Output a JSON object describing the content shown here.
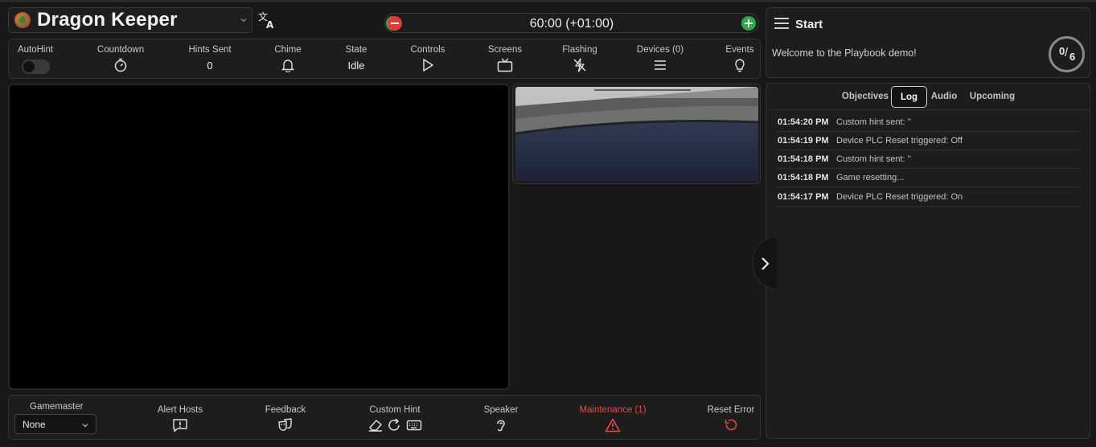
{
  "app": {
    "title": "Dragon Keeper"
  },
  "timer": {
    "display": "60:00 (+01:00)"
  },
  "toolbar": {
    "autohint": {
      "label": "AutoHint",
      "on": false
    },
    "countdown": {
      "label": "Countdown"
    },
    "hints_sent": {
      "label": "Hints Sent",
      "value": "0"
    },
    "chime": {
      "label": "Chime"
    },
    "state": {
      "label": "State",
      "value": "Idle"
    },
    "controls": {
      "label": "Controls"
    },
    "screens": {
      "label": "Screens"
    },
    "flashing": {
      "label": "Flashing"
    },
    "devices": {
      "label": "Devices (0)"
    },
    "events": {
      "label": "Events"
    }
  },
  "bottom": {
    "gamemaster": {
      "label": "Gamemaster",
      "selected": "None"
    },
    "alert_hosts": {
      "label": "Alert Hosts"
    },
    "feedback": {
      "label": "Feedback"
    },
    "custom_hint": {
      "label": "Custom Hint"
    },
    "speaker": {
      "label": "Speaker"
    },
    "maintenance": {
      "label": "Maintenance (1)"
    },
    "reset_error": {
      "label": "Reset Error"
    }
  },
  "start_panel": {
    "title": "Start",
    "welcome": "Welcome to the Playbook demo!",
    "progress": {
      "done": "0",
      "total": "6"
    }
  },
  "tabs": [
    {
      "label": "Objectives",
      "active": false
    },
    {
      "label": "Log",
      "active": true
    },
    {
      "label": "Audio",
      "active": false
    },
    {
      "label": "Upcoming",
      "active": false
    }
  ],
  "log": [
    {
      "time": "01:54:20 PM",
      "message": "Custom hint sent: ''"
    },
    {
      "time": "01:54:19 PM",
      "message": "Device PLC Reset triggered: Off"
    },
    {
      "time": "01:54:18 PM",
      "message": "Custom hint sent: ''"
    },
    {
      "time": "01:54:18 PM",
      "message": "Game resetting..."
    },
    {
      "time": "01:54:17 PM",
      "message": "Device PLC Reset triggered: On"
    }
  ],
  "colors": {
    "background": "#181818",
    "panel": "#1d1d1d",
    "alert_red": "#e24a4a",
    "timer_plus": "#2fa84a",
    "timer_minus": "#e23a3a"
  },
  "icons": {
    "translate": "translate-icon",
    "countdown": "stopwatch-icon",
    "chime": "bell-icon",
    "controls": "play-icon",
    "screens": "tv-icon",
    "flashing": "flash-off-icon",
    "devices": "list-icon",
    "events": "lightbulb-icon",
    "alert_hosts": "alert-message-icon",
    "feedback": "theater-masks-icon",
    "custom_hint": [
      "eraser-icon",
      "refresh-icon",
      "keyboard-icon"
    ],
    "speaker": "ear-icon",
    "maintenance": "warning-icon",
    "reset_error": "reset-icon",
    "menu": "hamburger-menu-icon",
    "expand": "chevron-right-icon"
  }
}
